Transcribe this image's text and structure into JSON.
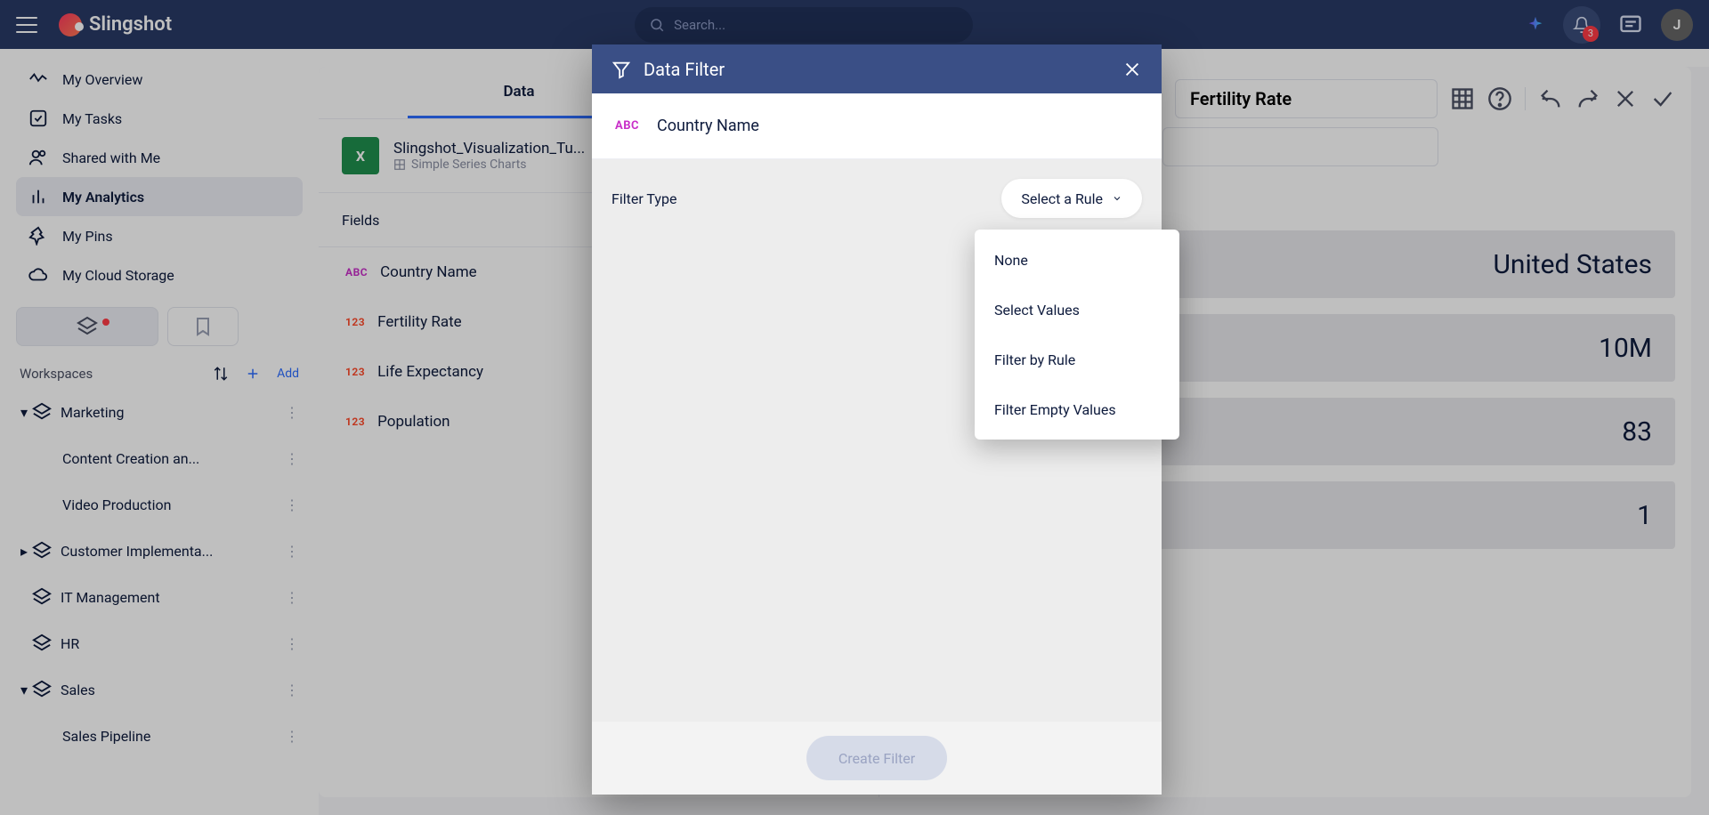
{
  "topbar": {
    "brand": "Slingshot",
    "search_placeholder": "Search...",
    "notification_count": "3",
    "avatar_initial": "J"
  },
  "sidebar": {
    "nav": [
      {
        "label": "My Overview"
      },
      {
        "label": "My Tasks"
      },
      {
        "label": "Shared with Me"
      },
      {
        "label": "My Analytics"
      },
      {
        "label": "My Pins"
      },
      {
        "label": "My Cloud Storage"
      }
    ],
    "workspaces_label": "Workspaces",
    "add_label": "Add",
    "tree": {
      "marketing": "Marketing",
      "content": "Content Creation an...",
      "video": "Video Production",
      "customer": "Customer Implementa...",
      "it": "IT Management",
      "hr": "HR",
      "sales": "Sales",
      "pipeline": "Sales Pipeline"
    }
  },
  "editor": {
    "tab_data": "Data",
    "source_title": "Slingshot_Visualization_Tu...",
    "source_sub": "Simple Series Charts",
    "fields_label": "Fields",
    "fields": {
      "country": "Country Name",
      "fertility": "Fertility Rate",
      "life": "Life Expectancy",
      "population": "Population"
    }
  },
  "viz": {
    "title": "Fertility Rate",
    "rows": {
      "country": "United States",
      "population": "10M",
      "life": "83",
      "fertility": "1"
    }
  },
  "modal": {
    "title": "Data Filter",
    "field_name": "Country Name",
    "filter_type_label": "Filter Type",
    "select_label": "Select a Rule",
    "create_label": "Create Filter",
    "menu": {
      "none": "None",
      "select_values": "Select Values",
      "by_rule": "Filter by Rule",
      "empty": "Filter Empty Values"
    }
  }
}
